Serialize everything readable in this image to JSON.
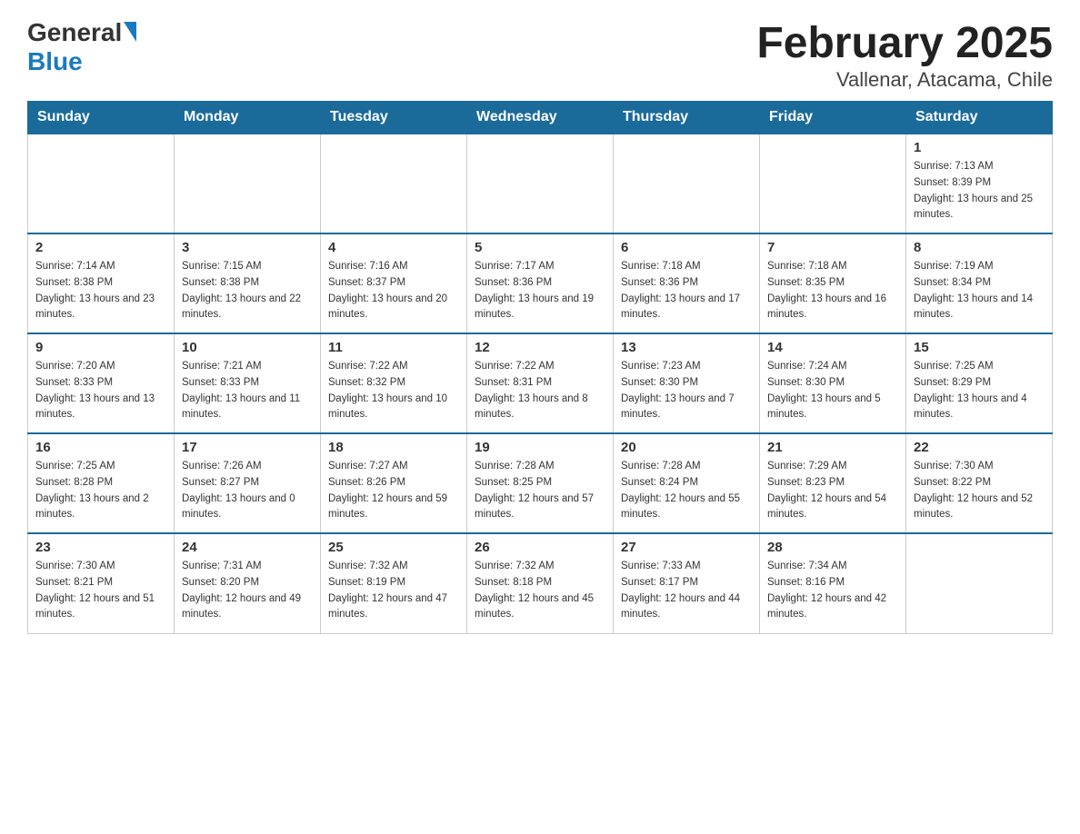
{
  "header": {
    "logo_general": "General",
    "logo_blue": "Blue",
    "title": "February 2025",
    "subtitle": "Vallenar, Atacama, Chile"
  },
  "days_of_week": [
    "Sunday",
    "Monday",
    "Tuesday",
    "Wednesday",
    "Thursday",
    "Friday",
    "Saturday"
  ],
  "weeks": [
    [
      {
        "day": "",
        "info": ""
      },
      {
        "day": "",
        "info": ""
      },
      {
        "day": "",
        "info": ""
      },
      {
        "day": "",
        "info": ""
      },
      {
        "day": "",
        "info": ""
      },
      {
        "day": "",
        "info": ""
      },
      {
        "day": "1",
        "info": "Sunrise: 7:13 AM\nSunset: 8:39 PM\nDaylight: 13 hours and 25 minutes."
      }
    ],
    [
      {
        "day": "2",
        "info": "Sunrise: 7:14 AM\nSunset: 8:38 PM\nDaylight: 13 hours and 23 minutes."
      },
      {
        "day": "3",
        "info": "Sunrise: 7:15 AM\nSunset: 8:38 PM\nDaylight: 13 hours and 22 minutes."
      },
      {
        "day": "4",
        "info": "Sunrise: 7:16 AM\nSunset: 8:37 PM\nDaylight: 13 hours and 20 minutes."
      },
      {
        "day": "5",
        "info": "Sunrise: 7:17 AM\nSunset: 8:36 PM\nDaylight: 13 hours and 19 minutes."
      },
      {
        "day": "6",
        "info": "Sunrise: 7:18 AM\nSunset: 8:36 PM\nDaylight: 13 hours and 17 minutes."
      },
      {
        "day": "7",
        "info": "Sunrise: 7:18 AM\nSunset: 8:35 PM\nDaylight: 13 hours and 16 minutes."
      },
      {
        "day": "8",
        "info": "Sunrise: 7:19 AM\nSunset: 8:34 PM\nDaylight: 13 hours and 14 minutes."
      }
    ],
    [
      {
        "day": "9",
        "info": "Sunrise: 7:20 AM\nSunset: 8:33 PM\nDaylight: 13 hours and 13 minutes."
      },
      {
        "day": "10",
        "info": "Sunrise: 7:21 AM\nSunset: 8:33 PM\nDaylight: 13 hours and 11 minutes."
      },
      {
        "day": "11",
        "info": "Sunrise: 7:22 AM\nSunset: 8:32 PM\nDaylight: 13 hours and 10 minutes."
      },
      {
        "day": "12",
        "info": "Sunrise: 7:22 AM\nSunset: 8:31 PM\nDaylight: 13 hours and 8 minutes."
      },
      {
        "day": "13",
        "info": "Sunrise: 7:23 AM\nSunset: 8:30 PM\nDaylight: 13 hours and 7 minutes."
      },
      {
        "day": "14",
        "info": "Sunrise: 7:24 AM\nSunset: 8:30 PM\nDaylight: 13 hours and 5 minutes."
      },
      {
        "day": "15",
        "info": "Sunrise: 7:25 AM\nSunset: 8:29 PM\nDaylight: 13 hours and 4 minutes."
      }
    ],
    [
      {
        "day": "16",
        "info": "Sunrise: 7:25 AM\nSunset: 8:28 PM\nDaylight: 13 hours and 2 minutes."
      },
      {
        "day": "17",
        "info": "Sunrise: 7:26 AM\nSunset: 8:27 PM\nDaylight: 13 hours and 0 minutes."
      },
      {
        "day": "18",
        "info": "Sunrise: 7:27 AM\nSunset: 8:26 PM\nDaylight: 12 hours and 59 minutes."
      },
      {
        "day": "19",
        "info": "Sunrise: 7:28 AM\nSunset: 8:25 PM\nDaylight: 12 hours and 57 minutes."
      },
      {
        "day": "20",
        "info": "Sunrise: 7:28 AM\nSunset: 8:24 PM\nDaylight: 12 hours and 55 minutes."
      },
      {
        "day": "21",
        "info": "Sunrise: 7:29 AM\nSunset: 8:23 PM\nDaylight: 12 hours and 54 minutes."
      },
      {
        "day": "22",
        "info": "Sunrise: 7:30 AM\nSunset: 8:22 PM\nDaylight: 12 hours and 52 minutes."
      }
    ],
    [
      {
        "day": "23",
        "info": "Sunrise: 7:30 AM\nSunset: 8:21 PM\nDaylight: 12 hours and 51 minutes."
      },
      {
        "day": "24",
        "info": "Sunrise: 7:31 AM\nSunset: 8:20 PM\nDaylight: 12 hours and 49 minutes."
      },
      {
        "day": "25",
        "info": "Sunrise: 7:32 AM\nSunset: 8:19 PM\nDaylight: 12 hours and 47 minutes."
      },
      {
        "day": "26",
        "info": "Sunrise: 7:32 AM\nSunset: 8:18 PM\nDaylight: 12 hours and 45 minutes."
      },
      {
        "day": "27",
        "info": "Sunrise: 7:33 AM\nSunset: 8:17 PM\nDaylight: 12 hours and 44 minutes."
      },
      {
        "day": "28",
        "info": "Sunrise: 7:34 AM\nSunset: 8:16 PM\nDaylight: 12 hours and 42 minutes."
      },
      {
        "day": "",
        "info": ""
      }
    ]
  ]
}
